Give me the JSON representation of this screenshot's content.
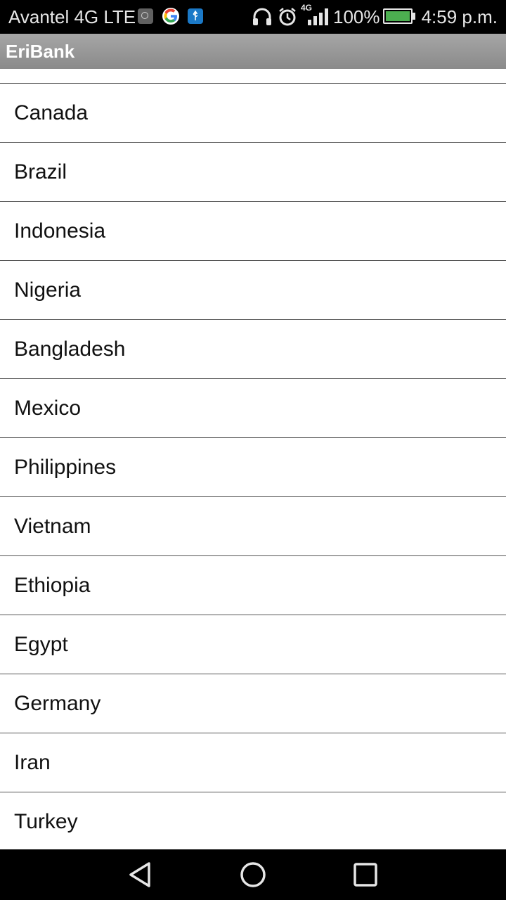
{
  "status_bar": {
    "carrier": "Avantel 4G LTE",
    "network_type": "4G",
    "battery_percent": "100%",
    "time": "4:59 p.m.",
    "icons": [
      "app-notification-icon",
      "google-icon",
      "usb-icon",
      "headphones-icon",
      "alarm-icon",
      "signal-icon",
      "battery-charging-icon"
    ]
  },
  "app_bar": {
    "title": "EriBank"
  },
  "countries": [
    "Canada",
    "Brazil",
    "Indonesia",
    "Nigeria",
    "Bangladesh",
    "Mexico",
    "Philippines",
    "Vietnam",
    "Ethiopia",
    "Egypt",
    "Germany",
    "Iran",
    "Turkey"
  ],
  "navigation": {
    "buttons": [
      "back",
      "home",
      "recent-apps"
    ]
  },
  "colors": {
    "app_bar": "#9a9a9a",
    "battery": "#4caf50",
    "usb_icon": "#1b79c7"
  }
}
